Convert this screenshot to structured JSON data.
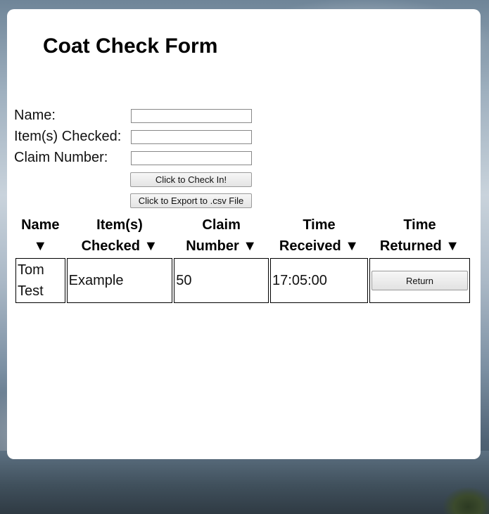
{
  "page": {
    "title": "Coat Check Form"
  },
  "form": {
    "name_label": "Name:",
    "items_label": "Item(s) Checked:",
    "claim_label": "Claim Number:",
    "name_value": "",
    "items_value": "",
    "claim_value": "",
    "check_in_button": "Click to Check In!",
    "export_button": "Click to Export to .csv File"
  },
  "table": {
    "headers": [
      {
        "line1": "Name",
        "line2": "▼"
      },
      {
        "line1": "Item(s)",
        "line2": "Checked ▼"
      },
      {
        "line1": "Claim",
        "line2": "Number ▼"
      },
      {
        "line1": "Time",
        "line2": "Received ▼"
      },
      {
        "line1": "Time",
        "line2": "Returned ▼"
      }
    ],
    "rows": [
      {
        "name": "Tom Test",
        "items": "Example",
        "claim_number": "50",
        "time_received": "17:05:00",
        "return_button": "Return"
      }
    ]
  }
}
